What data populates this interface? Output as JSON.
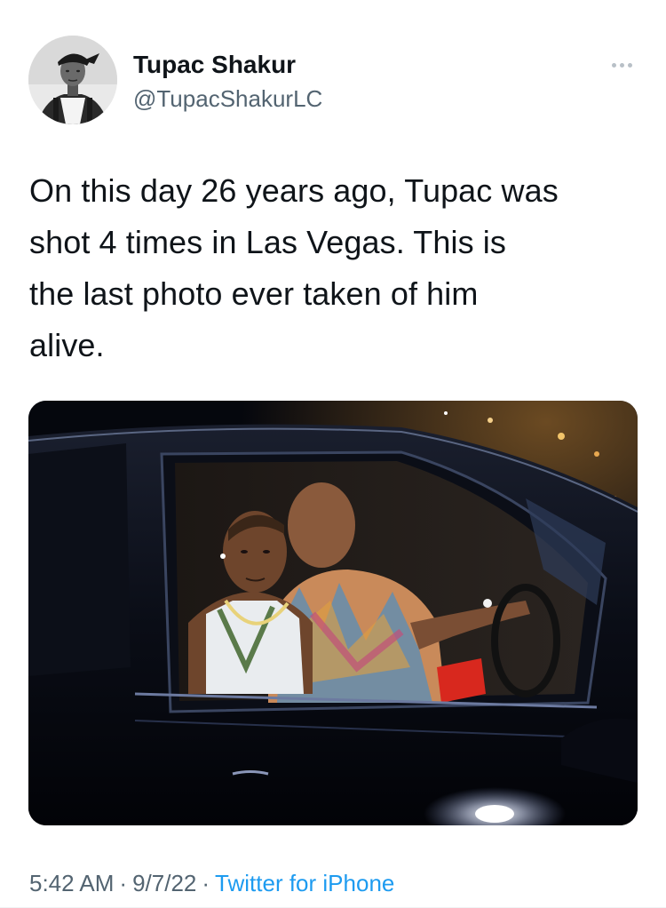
{
  "author": {
    "name": "Tupac Shakur",
    "handle": "@TupacShakurLC"
  },
  "tweet": {
    "text": "On this day 26 years ago, Tupac was\nshot 4 times in Las Vegas. This is\nthe last photo ever taken of him\nalive.",
    "time": "5:42 AM",
    "date": "9/7/22",
    "separator": "·",
    "source": "Twitter for iPhone"
  },
  "colors": {
    "text": "#0f1419",
    "secondary": "#536471",
    "link": "#1d9bf0"
  }
}
